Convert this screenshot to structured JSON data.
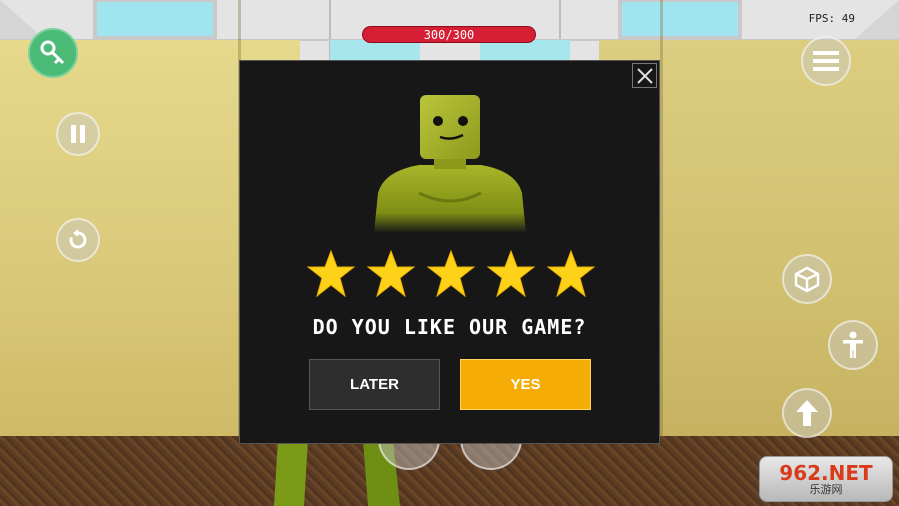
{
  "hud": {
    "health_text": "300/300",
    "fps_text": "FPS: 49"
  },
  "dialog": {
    "question": "DO YOU LIKE OUR GAME?",
    "later_label": "LATER",
    "yes_label": "YES",
    "rating": {
      "filled": 5,
      "max": 5
    },
    "star_color": "#ffd21a"
  },
  "side_controls": {
    "left": [
      "key-icon",
      "pause-icon",
      "restart-icon"
    ],
    "right": [
      "menu-icon",
      "cube-icon",
      "person-icon",
      "arrow-up-icon"
    ]
  },
  "watermark": {
    "brand_main": "962.NET",
    "brand_sub": "乐游网"
  },
  "colors": {
    "health_bar": "#d61f35",
    "yes_button": "#f6ac06",
    "later_button": "#2e2e2e",
    "dialog_bg": "#171717"
  }
}
